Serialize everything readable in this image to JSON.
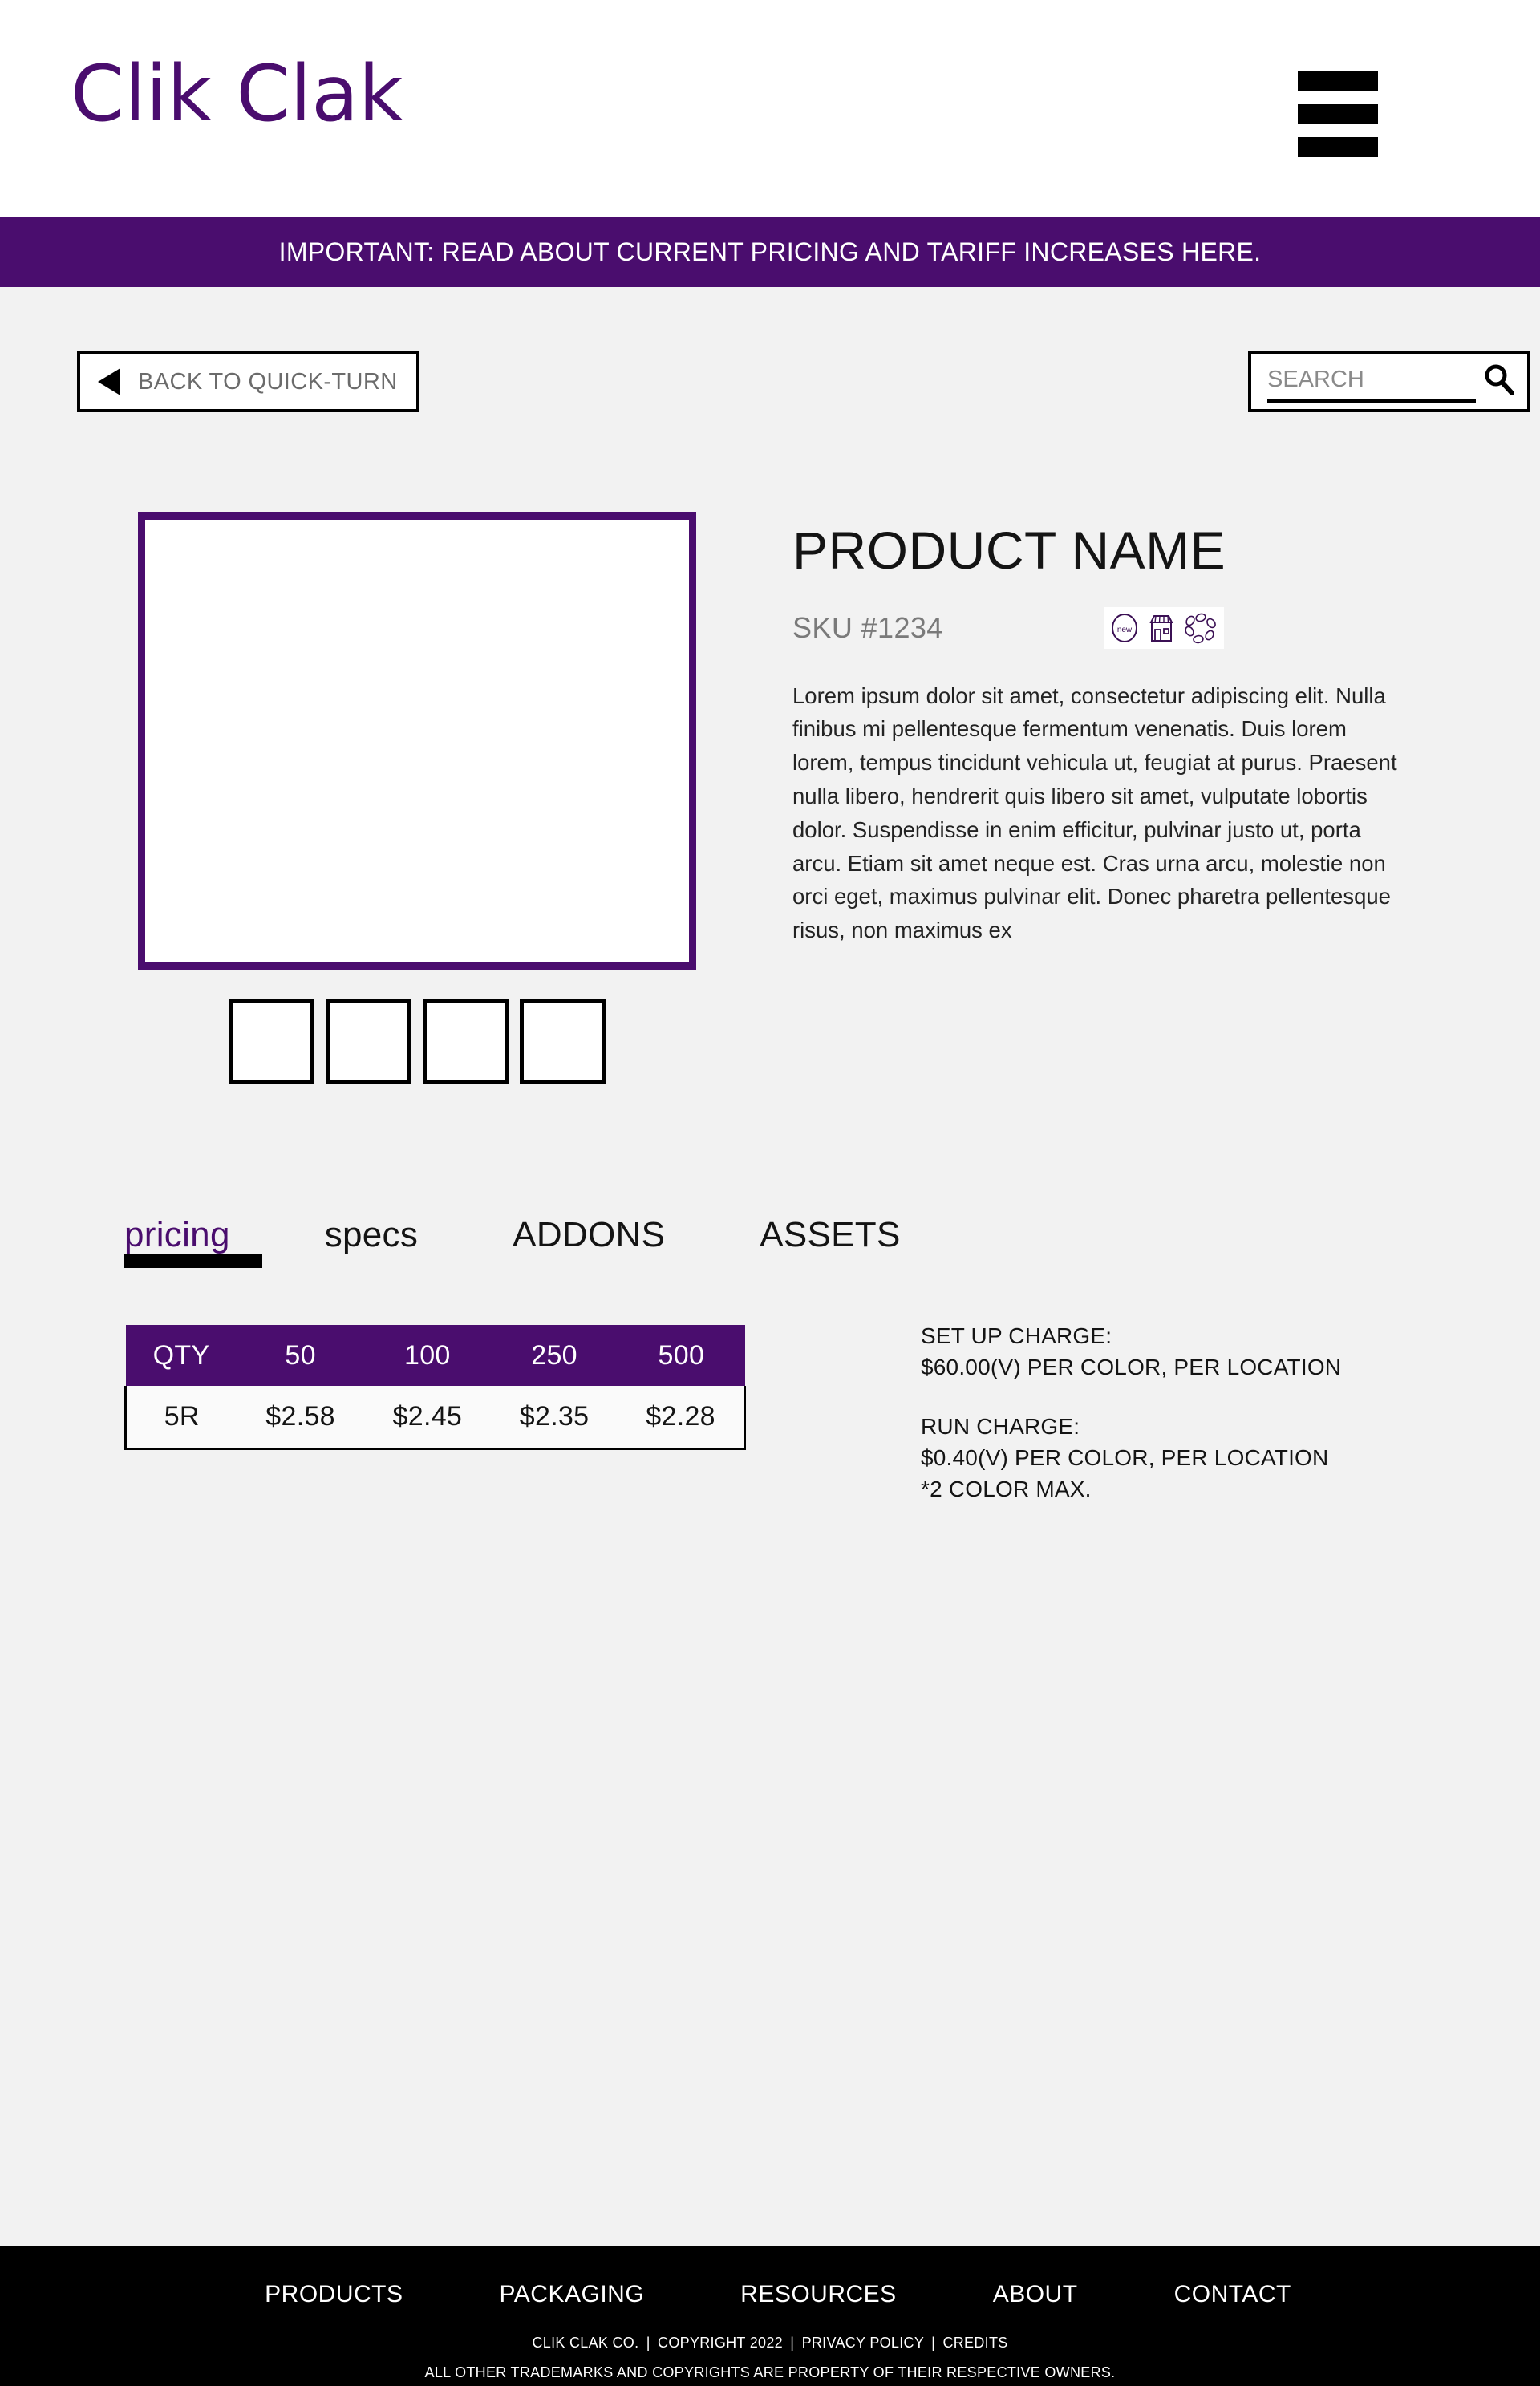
{
  "header": {
    "brand": "Clik Clak",
    "menu_icon": "hamburger-icon"
  },
  "announcement": {
    "text": "IMPORTANT: READ ABOUT CURRENT PRICING AND TARIFF INCREASES HERE."
  },
  "utility": {
    "back_label": "BACK TO QUICK-TURN",
    "back_icon": "left-triangle-icon",
    "search_placeholder": "SEARCH",
    "search_value": "",
    "search_icon": "magnifier-icon"
  },
  "product": {
    "title": "PRODUCT NAME",
    "sku": "SKU #1234",
    "badges": [
      {
        "name": "new-badge-icon",
        "label": "new"
      },
      {
        "name": "storefront-icon",
        "label": "retail"
      },
      {
        "name": "recycle-leaves-icon",
        "label": "eco"
      }
    ],
    "description": "Lorem ipsum dolor sit amet, consectetur adipiscing elit. Nulla finibus mi pellentesque fermentum venenatis. Duis lorem lorem, tempus tincidunt vehicula ut, feugiat at purus. Praesent nulla libero, hendrerit quis libero sit amet, vulputate lobortis dolor. Suspendisse in enim efficitur, pulvinar justo ut, porta arcu. Etiam sit amet neque est. Cras urna arcu, molestie non orci eget, maximus pulvinar elit. Donec pharetra pellentesque risus, non maximus ex",
    "thumbnails": [
      "thumb-1",
      "thumb-2",
      "thumb-3",
      "thumb-4"
    ]
  },
  "tabs": [
    {
      "label": "pricing",
      "active": true
    },
    {
      "label": "specs",
      "active": false
    },
    {
      "label": "ADDONS",
      "active": false
    },
    {
      "label": "ASSETS",
      "active": false
    }
  ],
  "pricing": {
    "headers": [
      "QTY",
      "50",
      "100",
      "250",
      "500"
    ],
    "rows": [
      [
        "5R",
        "$2.58",
        "$2.45",
        "$2.35",
        "$2.28"
      ]
    ]
  },
  "charges": {
    "setup_title": "SET UP CHARGE:",
    "setup_value": "$60.00(V) PER COLOR, PER LOCATION",
    "run_title": "RUN CHARGE:",
    "run_value": "$0.40(V) PER COLOR, PER LOCATION",
    "run_note": "*2 COLOR MAX."
  },
  "footer": {
    "nav": [
      "PRODUCTS",
      "PACKAGING",
      "RESOURCES",
      "ABOUT",
      "CONTACT"
    ],
    "legal_company": "CLIK CLAK CO.",
    "legal_copyright": "COPYRIGHT 2022",
    "legal_privacy": "PRIVACY POLICY",
    "legal_credits": "CREDITS",
    "legal_trademarks": "ALL OTHER TRADEMARKS AND COPYRIGHTS ARE PROPERTY OF THEIR RESPECTIVE OWNERS.",
    "separator": "|"
  },
  "colors": {
    "brand_purple": "#4a0d6e",
    "page_background": "#f2f2f2",
    "footer_background": "#000000",
    "text_muted": "#7a7a7a"
  }
}
